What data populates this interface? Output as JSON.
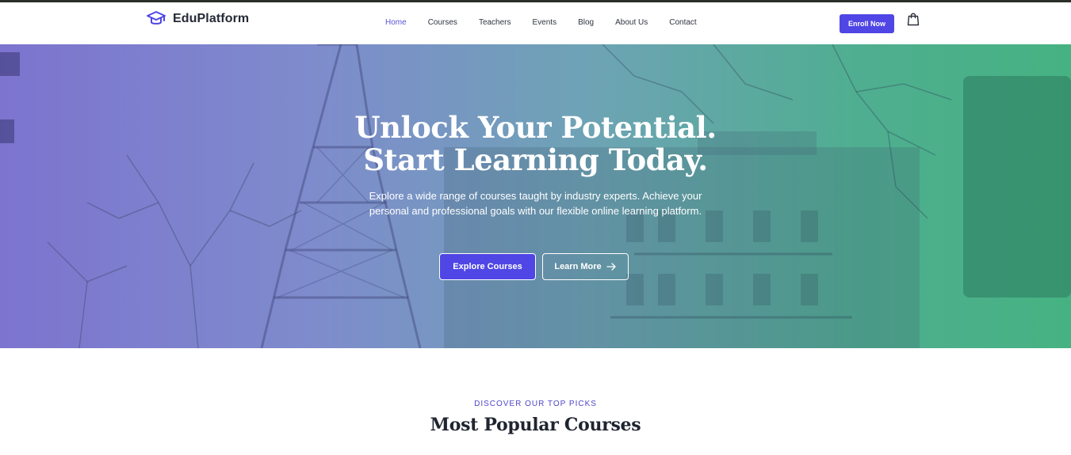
{
  "brand": {
    "name": "EduPlatform",
    "icon": "graduation-cap-icon",
    "accent": "#4f46e5"
  },
  "nav": {
    "items": [
      {
        "label": "Home",
        "active": true
      },
      {
        "label": "Courses",
        "active": false
      },
      {
        "label": "Teachers",
        "active": false
      },
      {
        "label": "Events",
        "active": false
      },
      {
        "label": "Blog",
        "active": false
      },
      {
        "label": "About Us",
        "active": false
      },
      {
        "label": "Contact",
        "active": false
      }
    ],
    "enroll_label": "Enroll Now",
    "cart_icon": "shopping-bag-icon"
  },
  "hero": {
    "title_line1": "Unlock Your Potential.",
    "title_line2": "Start Learning Today.",
    "description": "Explore a wide range of courses taught by industry experts. Achieve your personal and professional goals with our flexible online learning platform.",
    "primary_button": "Explore Courses",
    "secondary_button": "Learn More",
    "secondary_icon": "arrow-right-icon",
    "gradient": [
      "#7d74cf",
      "#46b282"
    ]
  },
  "section": {
    "eyebrow": "DISCOVER OUR TOP PICKS",
    "title": "Most Popular Courses"
  }
}
